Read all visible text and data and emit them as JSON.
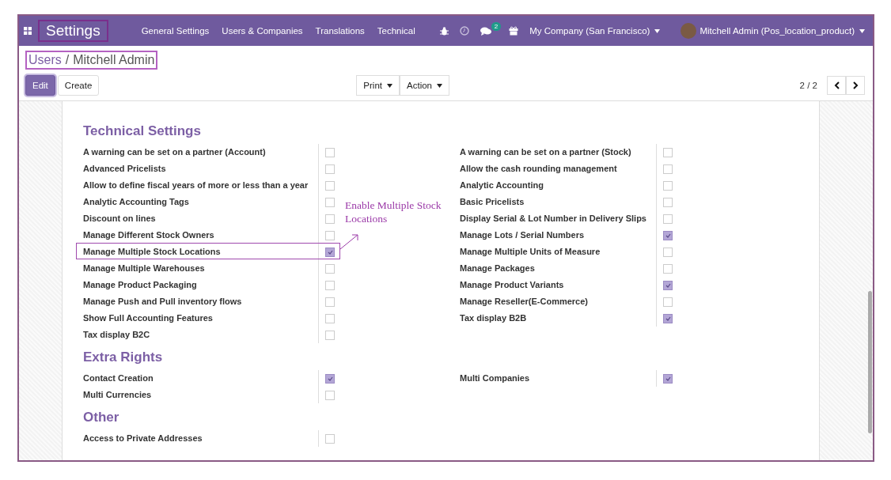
{
  "navbar": {
    "brand": {
      "label": "Settings",
      "highlighted": true
    },
    "menu": [
      "General Settings",
      "Users & Companies",
      "Translations",
      "Technical"
    ],
    "messages_badge": "2",
    "company": "My Company (San Francisco)",
    "user": "Mitchell Admin (Pos_location_product)"
  },
  "breadcrumb": {
    "parent": "Users",
    "separator": "/",
    "current": "Mitchell Admin",
    "highlighted": true
  },
  "buttons": [
    {
      "label": "Edit",
      "kind": "primary"
    },
    {
      "label": "Create",
      "kind": "secondary"
    }
  ],
  "actions": [
    "Print",
    "Action"
  ],
  "pager": "2 / 2",
  "sections": [
    {
      "title": "Technical Settings",
      "left": [
        {
          "label": "A warning can be set on a partner (Account)",
          "checked": false,
          "highlighted": false
        },
        {
          "label": "Advanced Pricelists",
          "checked": false,
          "highlighted": false
        },
        {
          "label": "Allow to define fiscal years of more or less than a year",
          "checked": false,
          "highlighted": false
        },
        {
          "label": "Analytic Accounting Tags",
          "checked": false,
          "highlighted": false
        },
        {
          "label": "Discount on lines",
          "checked": false,
          "highlighted": false
        },
        {
          "label": "Manage Different Stock Owners",
          "checked": false,
          "highlighted": false
        },
        {
          "label": "Manage Multiple Stock Locations",
          "checked": true,
          "highlighted": true
        },
        {
          "label": "Manage Multiple Warehouses",
          "checked": false,
          "highlighted": false
        },
        {
          "label": "Manage Product Packaging",
          "checked": false,
          "highlighted": false
        },
        {
          "label": "Manage Push and Pull inventory flows",
          "checked": false,
          "highlighted": false
        },
        {
          "label": "Show Full Accounting Features",
          "checked": false,
          "highlighted": false
        },
        {
          "label": "Tax display B2C",
          "checked": false,
          "highlighted": false
        }
      ],
      "right": [
        {
          "label": "A warning can be set on a partner (Stock)",
          "checked": false,
          "highlighted": false
        },
        {
          "label": "Allow the cash rounding management",
          "checked": false,
          "highlighted": false
        },
        {
          "label": "Analytic Accounting",
          "checked": false,
          "highlighted": false
        },
        {
          "label": "Basic Pricelists",
          "checked": false,
          "highlighted": false
        },
        {
          "label": "Display Serial & Lot Number in Delivery Slips",
          "checked": false,
          "highlighted": false
        },
        {
          "label": "Manage Lots / Serial Numbers",
          "checked": true,
          "highlighted": false
        },
        {
          "label": "Manage Multiple Units of Measure",
          "checked": false,
          "highlighted": false
        },
        {
          "label": "Manage Packages",
          "checked": false,
          "highlighted": false
        },
        {
          "label": "Manage Product Variants",
          "checked": true,
          "highlighted": false
        },
        {
          "label": "Manage Reseller(E-Commerce)",
          "checked": false,
          "highlighted": false
        },
        {
          "label": "Tax display B2B",
          "checked": true,
          "highlighted": false
        }
      ]
    },
    {
      "title": "Extra Rights",
      "left": [
        {
          "label": "Contact Creation",
          "checked": true,
          "highlighted": false
        },
        {
          "label": "Multi Currencies",
          "checked": false,
          "highlighted": false
        }
      ],
      "right": [
        {
          "label": "Multi Companies",
          "checked": true,
          "highlighted": false
        }
      ]
    },
    {
      "title": "Other",
      "left": [
        {
          "label": "Access to Private Addresses",
          "checked": false,
          "highlighted": false
        }
      ]
    }
  ],
  "annotation": "Enable Multiple Stock Locations"
}
